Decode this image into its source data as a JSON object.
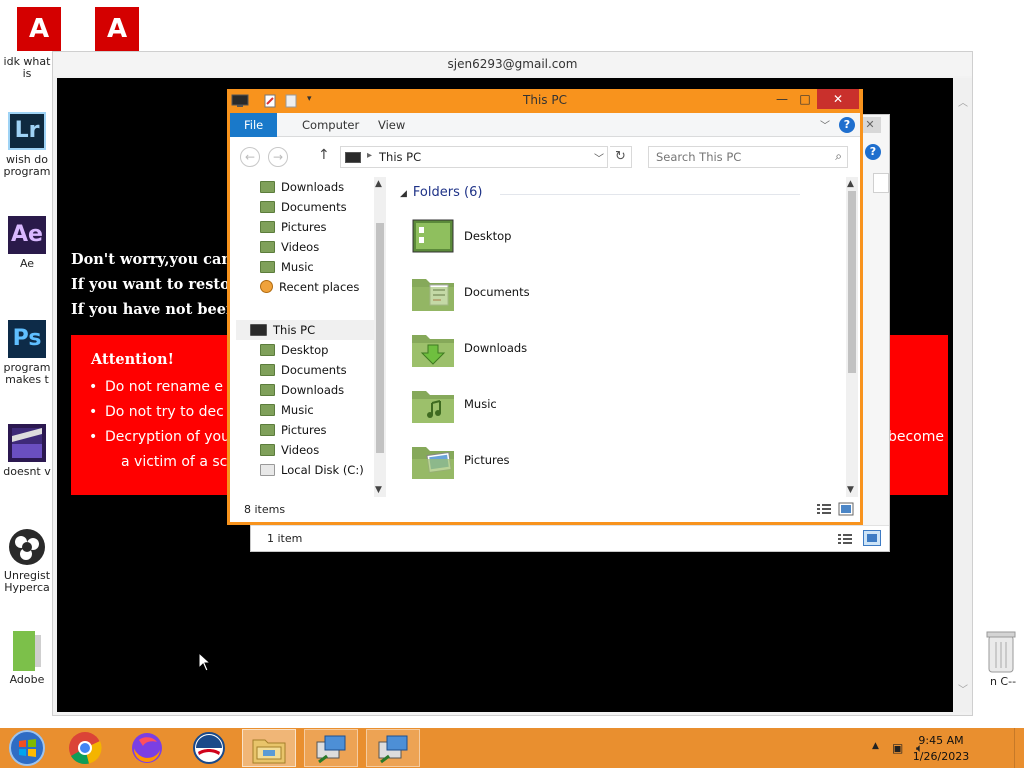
{
  "desktop": {
    "icons": [
      {
        "label": "idk what is",
        "name": "adobe"
      },
      {
        "label": "wish do program",
        "name": "lightroom",
        "glyph": "Lr"
      },
      {
        "label": "Ae",
        "name": "after-effects",
        "glyph": "Ae"
      },
      {
        "label": "program makes t",
        "name": "photoshop",
        "glyph": "Ps"
      },
      {
        "label": "doesnt v",
        "name": "premiere"
      },
      {
        "label": "Unregist Hyperca",
        "name": "obs"
      },
      {
        "label": "Adobe",
        "name": "adobe-folder"
      }
    ],
    "recycle_label": "n C--"
  },
  "remote": {
    "title": "sjen6293@gmail.com"
  },
  "ransom": {
    "line1": "Don't worry,you can r",
    "line2": "If you want to restore",
    "line3": "If you have not been a",
    "attention": "Attention!",
    "bullet1": "Do not rename e",
    "bullet2": "Do not try to dec",
    "bullet3": "Decryption of you",
    "bullet3_end": "become",
    "tail": "a victim of a scar"
  },
  "back_window": {
    "status": "1 item"
  },
  "explorer": {
    "title": "This PC",
    "tabs": [
      "File",
      "Computer",
      "View"
    ],
    "address": "This PC",
    "search_placeholder": "Search This PC",
    "nav_top": [
      "Downloads",
      "Documents",
      "Pictures",
      "Videos",
      "Music",
      "Recent places"
    ],
    "this_pc": "This PC",
    "nav_pc": [
      "Desktop",
      "Documents",
      "Downloads",
      "Music",
      "Pictures",
      "Videos",
      "Local Disk (C:)"
    ],
    "group_header": "Folders (6)",
    "folders": [
      "Desktop",
      "Documents",
      "Downloads",
      "Music",
      "Pictures"
    ],
    "status": "8 items"
  },
  "taskbar": {
    "time": "9:45 AM",
    "date": "1/26/2023"
  },
  "colors": {
    "window_accent": "#f8931d",
    "taskbar": "#e98f2f",
    "ransom_red": "#ff0000",
    "close_red": "#c9302c",
    "file_tab": "#1979ca"
  }
}
